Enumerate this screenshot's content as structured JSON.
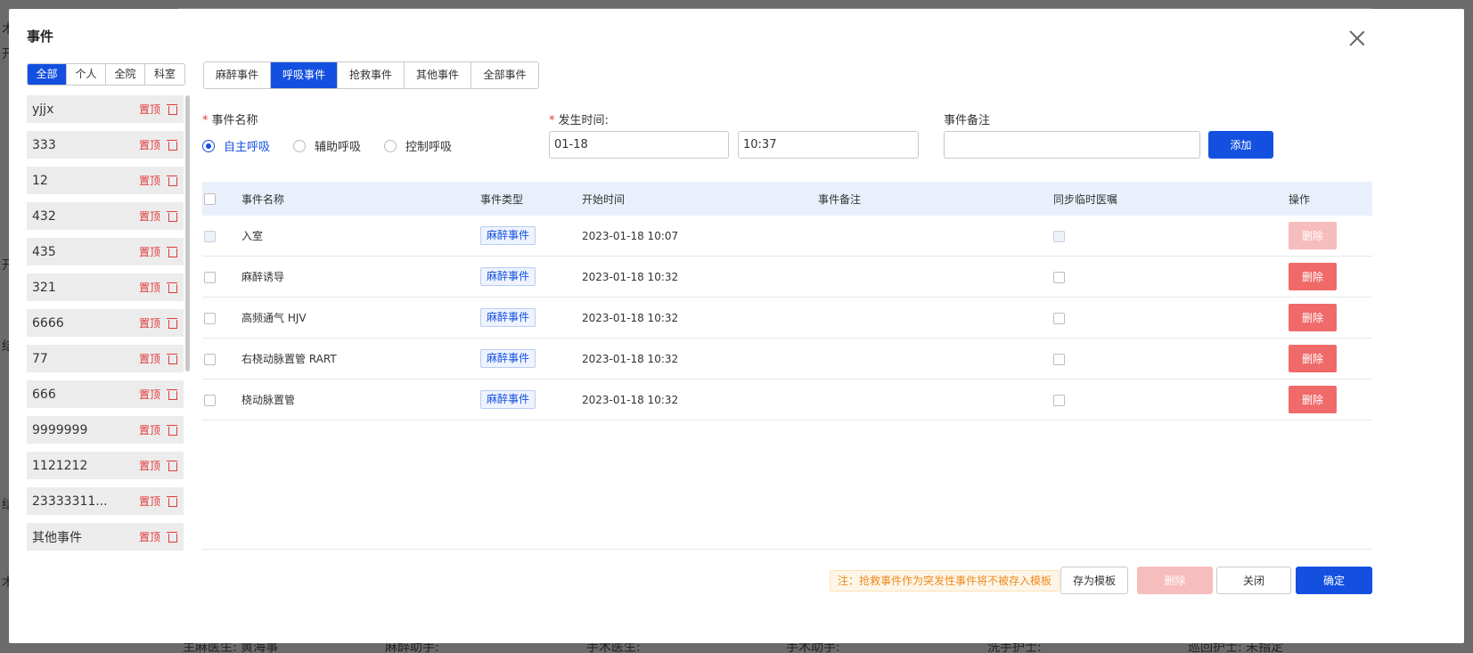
{
  "background": {
    "left_chars": [
      "术",
      "开",
      "开",
      "结",
      "结",
      "术"
    ],
    "bottom_fields": [
      "主麻医生: 黄海事",
      "麻醉助手:",
      "手术医生:",
      "手术助手:",
      "洗手护士:",
      "巡回护士: 未指定"
    ]
  },
  "modal": {
    "title": "事件"
  },
  "scope_tabs": [
    {
      "label": "全部",
      "active": true
    },
    {
      "label": "个人",
      "active": false
    },
    {
      "label": "全院",
      "active": false
    },
    {
      "label": "科室",
      "active": false
    }
  ],
  "templates": {
    "pin_label": "置顶",
    "items": [
      "yjjx",
      "333",
      "12",
      "432",
      "435",
      "321",
      "6666",
      "77",
      "666",
      "9999999",
      "1121212",
      "23333311...",
      "其他事件"
    ]
  },
  "category_tabs": [
    {
      "label": "麻醉事件",
      "active": false
    },
    {
      "label": "呼吸事件",
      "active": true
    },
    {
      "label": "抢救事件",
      "active": false
    },
    {
      "label": "其他事件",
      "active": false
    },
    {
      "label": "全部事件",
      "active": false
    }
  ],
  "form": {
    "name_label": "事件名称",
    "time_label": "发生时间:",
    "note_label": "事件备注",
    "radios": [
      {
        "label": "自主呼吸",
        "checked": true
      },
      {
        "label": "辅助呼吸",
        "checked": false
      },
      {
        "label": "控制呼吸",
        "checked": false
      }
    ],
    "date_value": "01-18",
    "time_value": "10:37",
    "note_value": "",
    "add_label": "添加"
  },
  "table": {
    "headers": {
      "name": "事件名称",
      "type": "事件类型",
      "time": "开始时间",
      "note": "事件备注",
      "sync": "同步临时医嘱",
      "op": "操作"
    },
    "delete_label": "删除",
    "rows": [
      {
        "name": "入室",
        "type": "麻醉事件",
        "time": "2023-01-18 10:07",
        "note": "",
        "disabled": true
      },
      {
        "name": "麻醉诱导",
        "type": "麻醉事件",
        "time": "2023-01-18 10:32",
        "note": "",
        "disabled": false
      },
      {
        "name": "高频通气 HJV",
        "type": "麻醉事件",
        "time": "2023-01-18 10:32",
        "note": "",
        "disabled": false
      },
      {
        "name": "右桡动脉置管 RART",
        "type": "麻醉事件",
        "time": "2023-01-18 10:32",
        "note": "",
        "disabled": false
      },
      {
        "name": "桡动脉置管",
        "type": "麻醉事件",
        "time": "2023-01-18 10:32",
        "note": "",
        "disabled": false
      }
    ]
  },
  "footer": {
    "notice": "注：抢救事件作为突发性事件将不被存入模板",
    "save_template": "存为模板",
    "delete": "删除",
    "close": "关闭",
    "confirm": "确定"
  },
  "colors": {
    "primary": "#1450e0",
    "danger": "#f06a6a",
    "warning_text": "#f08a1c"
  }
}
